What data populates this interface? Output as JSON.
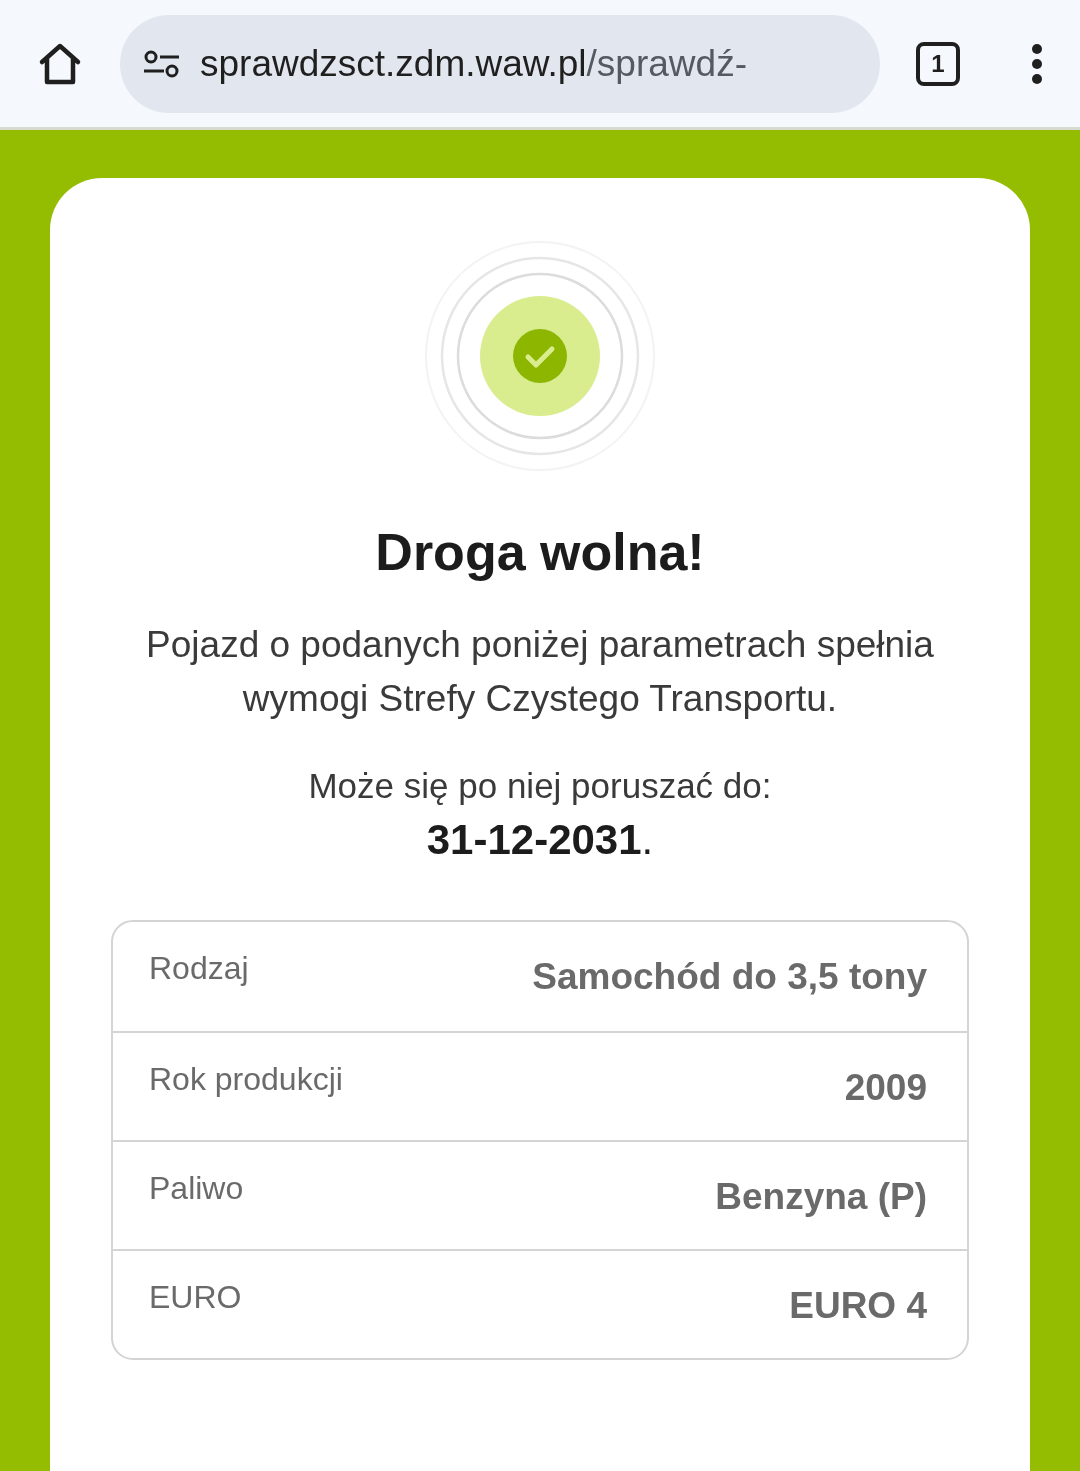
{
  "browser": {
    "url_host": "sprawdzsct.zdm.waw.pl",
    "url_path": "/sprawdź-",
    "tab_count": "1"
  },
  "result": {
    "title": "Droga wolna!",
    "description": "Pojazd o podanych poniżej parametrach spełnia wymogi Strefy Czystego Transportu.",
    "validity_label": "Może się po niej poruszać do:",
    "validity_date": "**31-12-2031**."
  },
  "details": [
    {
      "label": "Rodzaj",
      "value": "Samochód do 3,5 tony"
    },
    {
      "label": "Rok produkcji",
      "value": "2009"
    },
    {
      "label": "Paliwo",
      "value": "Benzyna (P)"
    },
    {
      "label": "EURO",
      "value": "EURO 4"
    }
  ]
}
